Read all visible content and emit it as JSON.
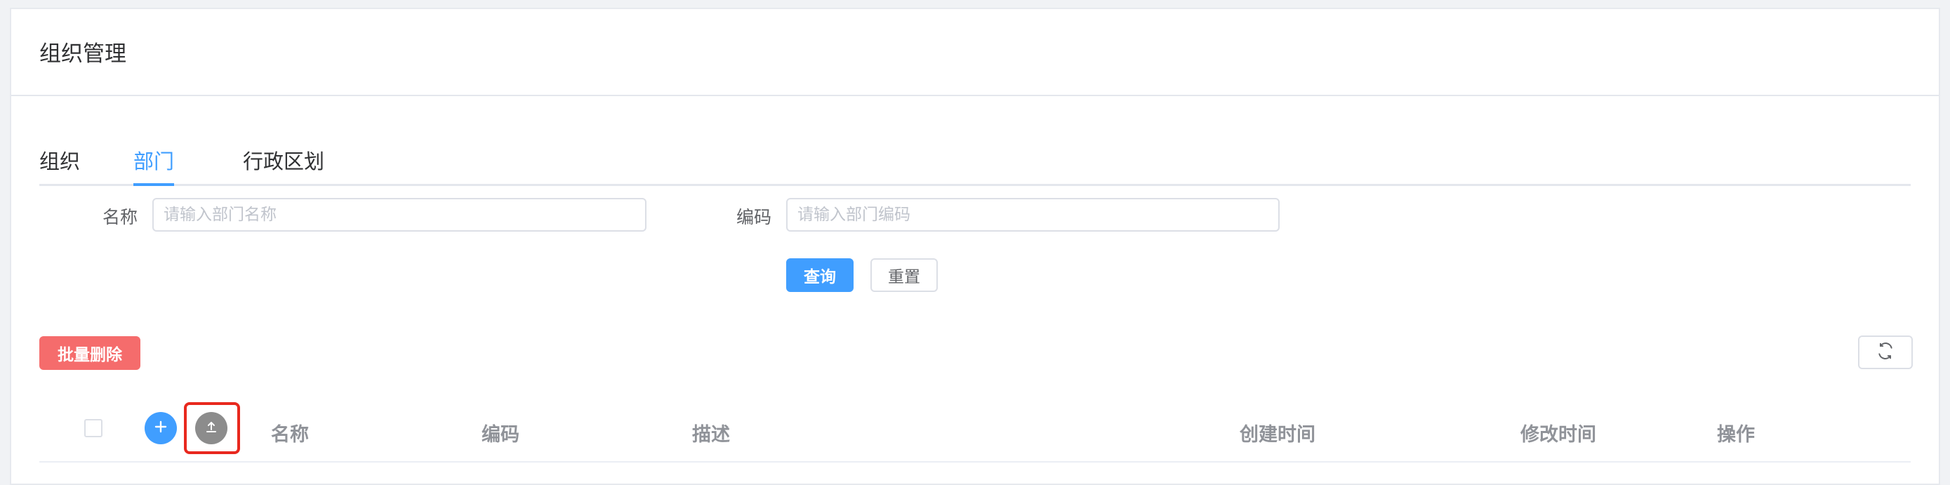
{
  "header": {
    "title": "组织管理"
  },
  "tabs": [
    {
      "label": "组织",
      "active": false
    },
    {
      "label": "部门",
      "active": true
    },
    {
      "label": "行政区划",
      "active": false
    }
  ],
  "filters": {
    "name": {
      "label": "名称",
      "placeholder": "请输入部门名称",
      "value": ""
    },
    "code": {
      "label": "编码",
      "placeholder": "请输入部门编码",
      "value": ""
    },
    "query_label": "查询",
    "reset_label": "重置"
  },
  "toolbar": {
    "batch_delete_label": "批量删除",
    "refresh_icon": "refresh-icon"
  },
  "table": {
    "columns": [
      "名称",
      "编码",
      "描述",
      "创建时间",
      "修改时间",
      "操作"
    ],
    "add_icon": "plus-icon",
    "upload_icon": "upload-icon"
  },
  "colors": {
    "primary": "#409eff",
    "danger": "#f56c6c",
    "highlight": "#e8281e"
  }
}
